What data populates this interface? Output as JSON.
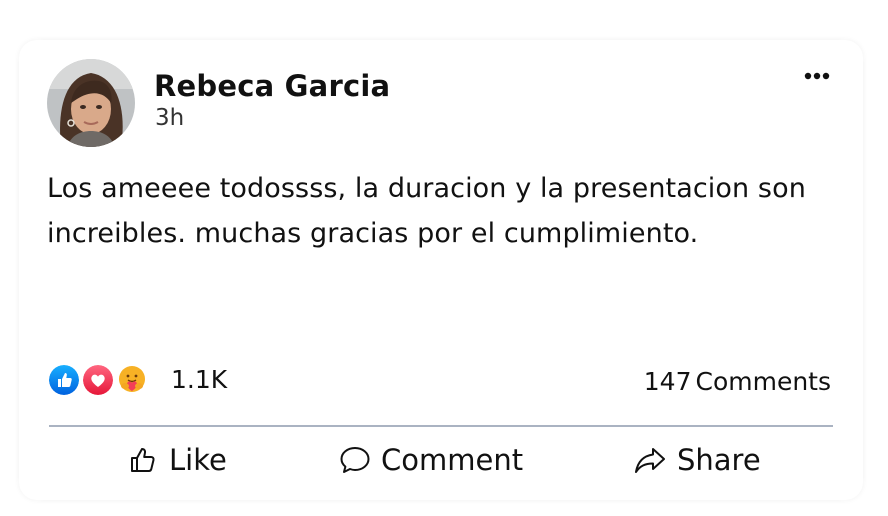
{
  "post": {
    "author_name": "Rebeca Garcia",
    "timestamp": "3h",
    "text": "Los ameeee todossss, la duracion y la presentacion son increibles. muchas gracias por el cumplimiento.",
    "more_icon": "more-horizontal-icon"
  },
  "reactions": {
    "icons": [
      "like-reaction-icon",
      "love-reaction-icon",
      "care-reaction-icon"
    ],
    "count": "1.1K"
  },
  "comments": {
    "count": "147",
    "label": "Comments"
  },
  "actions": {
    "like_label": "Like",
    "comment_label": "Comment",
    "share_label": "Share"
  },
  "colors": {
    "like_blue": "#1877f2",
    "love_red": "#f33e58",
    "care_yellow": "#f7b125",
    "divider": "#aab3c2"
  }
}
